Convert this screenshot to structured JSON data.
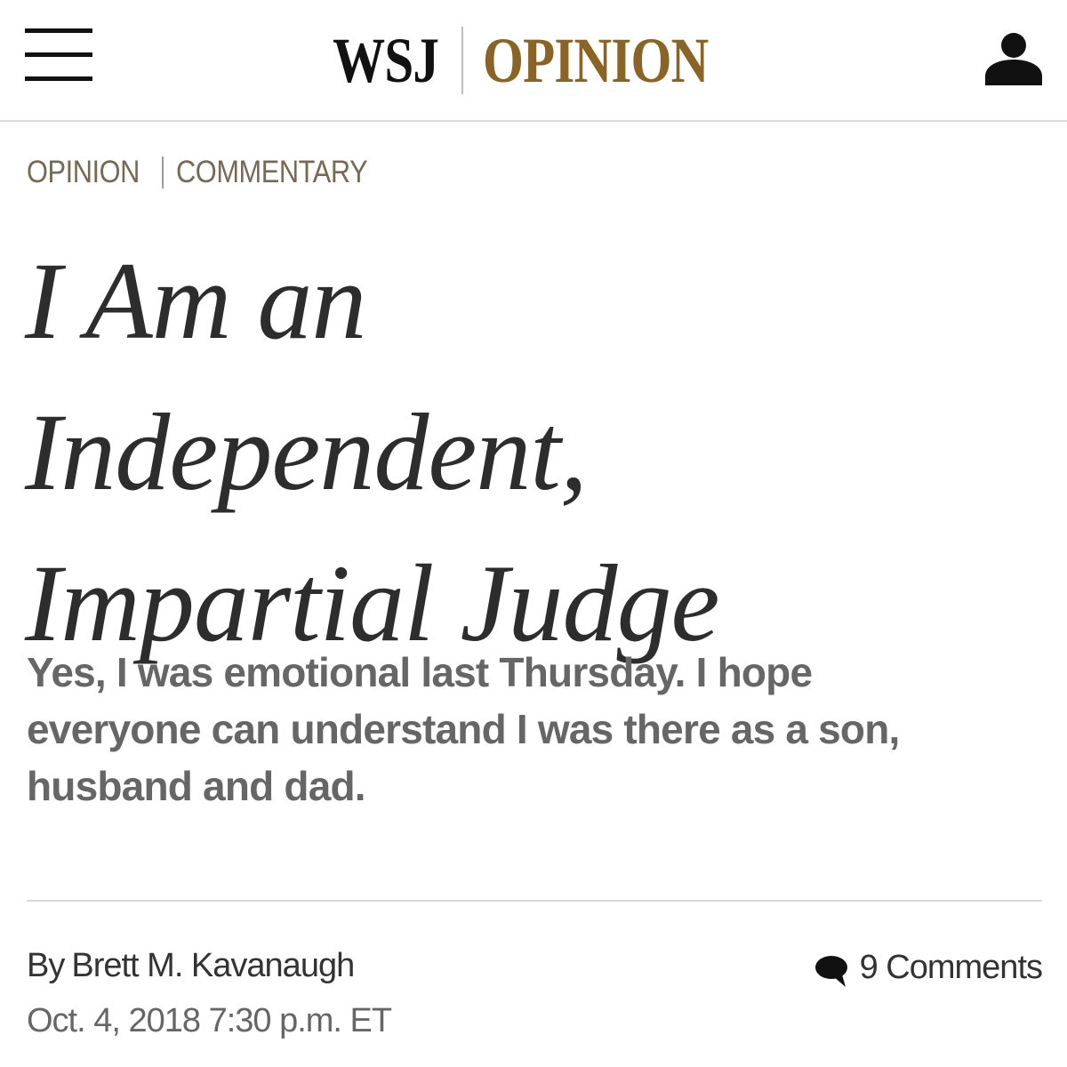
{
  "header": {
    "brand_wsj": "WSJ",
    "brand_section": "OPINION",
    "menu_icon": "hamburger-menu-icon",
    "account_icon": "user-account-icon",
    "brand_color": "#8a6424"
  },
  "article": {
    "section_primary": "OPINION",
    "section_secondary": "COMMENTARY",
    "headline_lines": [
      "I Am an",
      "Independent,",
      "Impartial Judge"
    ],
    "dek_lines": [
      "Yes, I was emotional last Thursday. I hope",
      "everyone can understand I was there as a son,",
      "husband and dad."
    ],
    "byline_prefix": "By",
    "author": "Brett M. Kavanaugh",
    "timestamp": "Oct. 4, 2018 7:30 p.m. ET",
    "comments_label": "9 Comments",
    "comments_icon": "speech-bubble-icon"
  }
}
